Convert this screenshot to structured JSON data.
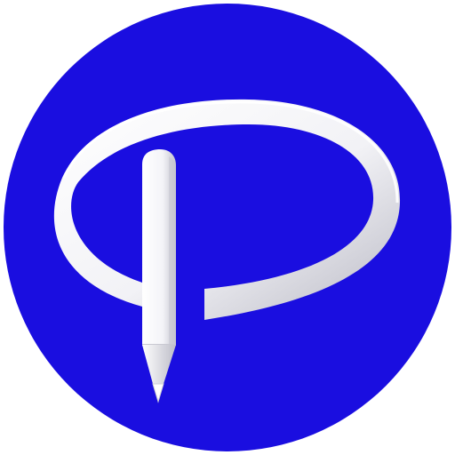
{
  "icon": {
    "name": "pencil-p-logo",
    "colors": {
      "background": "#ffffff",
      "disc": "#1a0ee0",
      "disc_edge": "#1208c8",
      "glyph_light": "#ffffff",
      "glyph_mid": "#e6e6ec",
      "glyph_shade": "#b9b9c4",
      "pencil_tip": "#d8d8de"
    }
  }
}
